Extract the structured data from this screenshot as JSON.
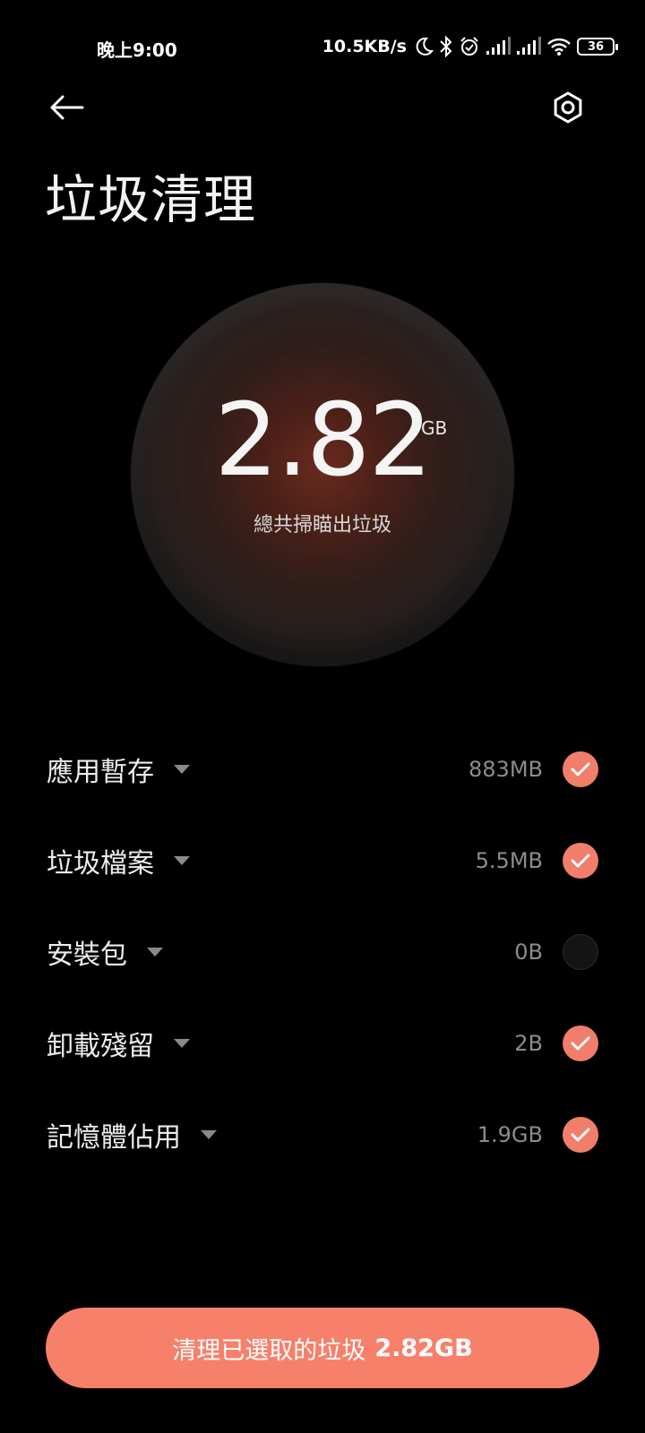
{
  "status_bar": {
    "time": "晚上9:00",
    "net_speed": "10.5KB/s",
    "battery_level": "36",
    "icons": [
      "moon-icon",
      "bluetooth-icon",
      "alarm-icon",
      "signal-icon",
      "signal-icon",
      "wifi-icon",
      "battery-icon"
    ]
  },
  "header": {
    "back_icon": "back-arrow-icon",
    "settings_icon": "settings-icon",
    "title": "垃圾清理"
  },
  "summary": {
    "value": "2.82",
    "unit": "GB",
    "caption": "總共掃瞄出垃圾"
  },
  "items": [
    {
      "label": "應用暫存",
      "size": "883MB",
      "checked": true
    },
    {
      "label": "垃圾檔案",
      "size": "5.5MB",
      "checked": true
    },
    {
      "label": "安裝包",
      "size": "0B",
      "checked": false
    },
    {
      "label": "卸載殘留",
      "size": "2B",
      "checked": true
    },
    {
      "label": "記憶體佔用",
      "size": "1.9GB",
      "checked": true
    }
  ],
  "action": {
    "label": "清理已選取的垃圾",
    "amount": "2.82GB"
  },
  "colors": {
    "accent": "#f7806b",
    "background": "#000000",
    "check_on": "#f07e6a"
  }
}
